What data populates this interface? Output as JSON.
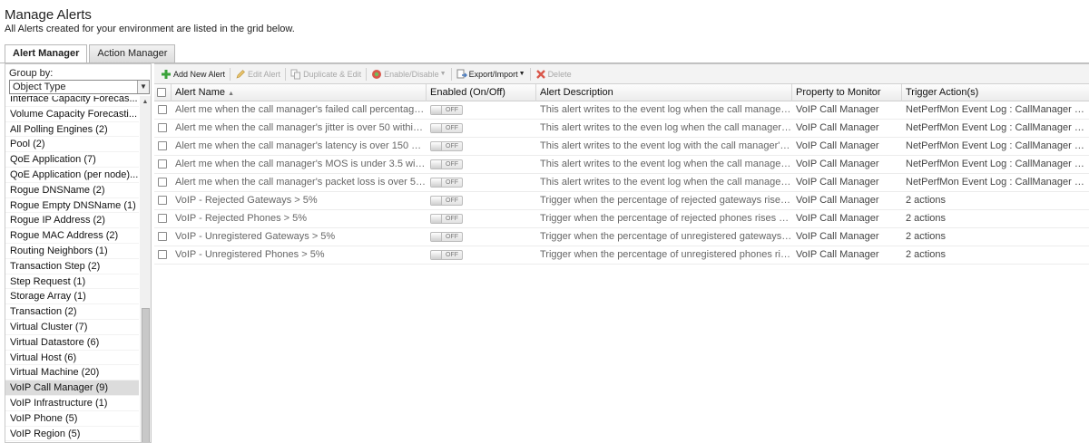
{
  "page": {
    "title": "Manage Alerts",
    "subtitle": "All Alerts created for your environment are listed in the grid below."
  },
  "tabs": [
    {
      "label": "Alert Manager",
      "active": true
    },
    {
      "label": "Action Manager",
      "active": false
    }
  ],
  "group_panel": {
    "label": "Group by:",
    "selected": "Object Type",
    "items": [
      "Interface Capacity Forecas...",
      "Volume Capacity Forecasti...",
      "All Polling Engines (2)",
      "Pool (2)",
      "QoE Application (7)",
      "QoE Application (per node)...",
      "Rogue DNSName (2)",
      "Rogue Empty DNSName (1)",
      "Rogue IP Address (2)",
      "Rogue MAC Address (2)",
      "Routing Neighbors (1)",
      "Transaction Step (2)",
      "Step Request (1)",
      "Storage Array (1)",
      "Transaction (2)",
      "Virtual Cluster (7)",
      "Virtual Datastore (6)",
      "Virtual Host (6)",
      "Virtual Machine (20)",
      "VoIP Call Manager (9)",
      "VoIP Infrastructure (1)",
      "VoIP Phone (5)",
      "VoIP Region (5)"
    ],
    "selected_item": "VoIP Call Manager (9)"
  },
  "toolbar": {
    "add": "Add New Alert",
    "edit": "Edit Alert",
    "duplicate": "Duplicate & Edit",
    "enable_disable": "Enable/Disable",
    "export_import": "Export/Import",
    "delete": "Delete"
  },
  "grid": {
    "columns": [
      "Alert Name",
      "Enabled (On/Off)",
      "Alert Description",
      "Property to Monitor",
      "Trigger Action(s)"
    ],
    "sort_indicator": "▲",
    "toggle_label": "OFF",
    "rows": [
      {
        "name": "Alert me when the call manager's failed call percentage i...",
        "enabled": "OFF",
        "description": "This alert writes to the event log when the call manager'...",
        "property": "VoIP Call Manager",
        "trigger": "NetPerfMon Event Log : CallManager ${N=S"
      },
      {
        "name": "Alert me when the call manager's jitter is over 50 within t...",
        "enabled": "OFF",
        "description": "This alert writes to the even log when the call manager's...",
        "property": "VoIP Call Manager",
        "trigger": "NetPerfMon Event Log : CallManager ${N=S"
      },
      {
        "name": "Alert me when the call manager's latency is over 150 wit...",
        "enabled": "OFF",
        "description": "This alert writes to the event log with the call manager's ...",
        "property": "VoIP Call Manager",
        "trigger": "NetPerfMon Event Log : CallManager ${N=S"
      },
      {
        "name": "Alert me when the call manager's MOS is under 3.5 withi...",
        "enabled": "OFF",
        "description": "This alert writes to the event log when the call manager'...",
        "property": "VoIP Call Manager",
        "trigger": "NetPerfMon Event Log : CallManager ${N=S"
      },
      {
        "name": "Alert me when the call manager's packet loss is over 5 ...",
        "enabled": "OFF",
        "description": "This alert writes to the event log when the call manager'...",
        "property": "VoIP Call Manager",
        "trigger": "NetPerfMon Event Log : CallManager ${N=S"
      },
      {
        "name": "VoIP - Rejected Gateways > 5%",
        "enabled": "OFF",
        "description": "Trigger when the percentage of rejected gateways rises ...",
        "property": "VoIP Call Manager",
        "trigger": "2 actions"
      },
      {
        "name": "VoIP - Rejected Phones > 5%",
        "enabled": "OFF",
        "description": "Trigger when the percentage of rejected phones rises ab...",
        "property": "VoIP Call Manager",
        "trigger": "2 actions"
      },
      {
        "name": "VoIP - Unregistered Gateways > 5%",
        "enabled": "OFF",
        "description": "Trigger when the percentage of unregistered gateways ri...",
        "property": "VoIP Call Manager",
        "trigger": "2 actions"
      },
      {
        "name": "VoIP - Unregistered Phones > 5%",
        "enabled": "OFF",
        "description": "Trigger when the percentage of unregistered phones rise...",
        "property": "VoIP Call Manager",
        "trigger": "2 actions"
      }
    ]
  },
  "icons": {
    "add": "plus-icon",
    "edit": "pencil-icon",
    "duplicate": "copy-icon",
    "enable_disable": "toggle-icon",
    "export_import": "export-icon",
    "delete": "delete-x-icon"
  },
  "colors": {
    "add_icon": "#3aa23a",
    "edit_icon": "#e2b44a",
    "enable_icon": "#d94b3b",
    "export_icon": "#4a7cc0",
    "delete_icon": "#d94b3b"
  }
}
